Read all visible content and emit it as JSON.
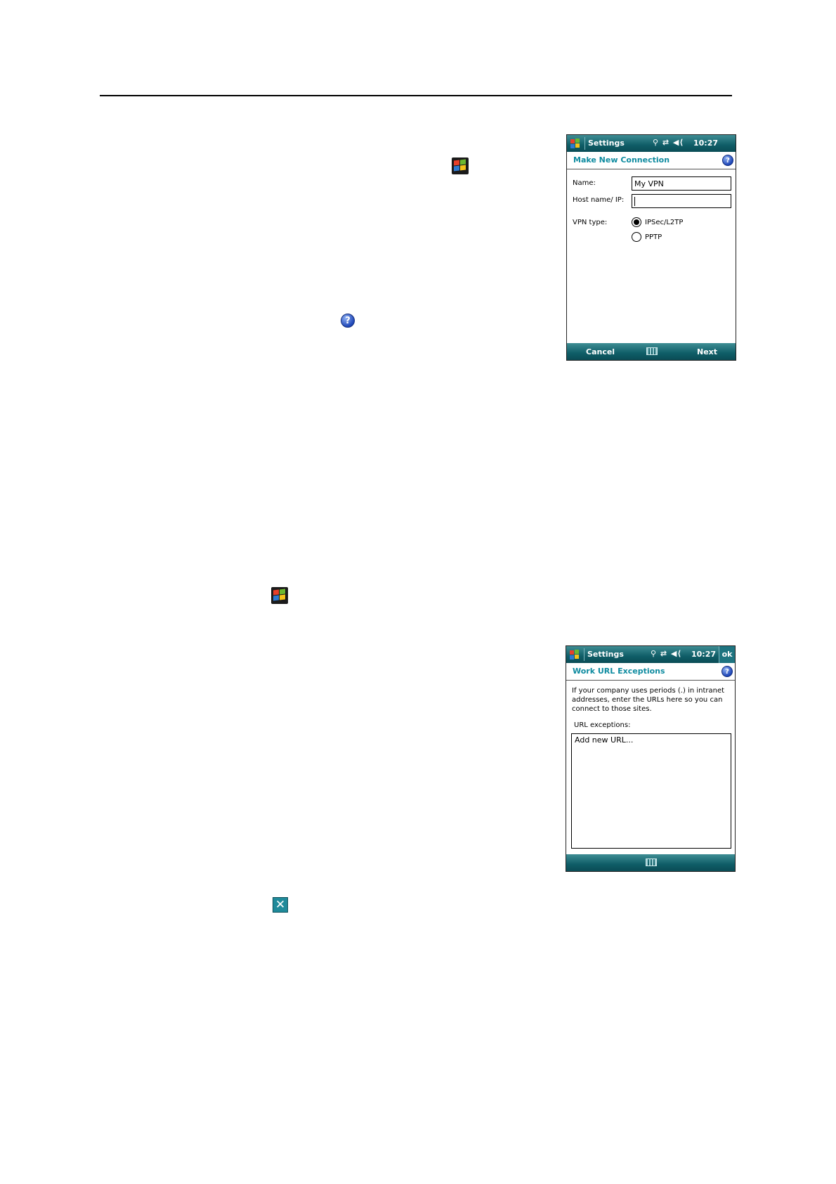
{
  "screen1": {
    "title": "Settings",
    "status_icons": "⚲ ⇄ ◀⟨",
    "time": "10:27",
    "header": "Make New Connection",
    "help_glyph": "?",
    "name_label": "Name:",
    "name_value": "My VPN",
    "host_label": "Host name/ IP:",
    "host_value": "",
    "vpn_type_label": "VPN type:",
    "options": [
      {
        "label": "IPSec/L2TP",
        "selected": true
      },
      {
        "label": "PPTP",
        "selected": false
      }
    ],
    "softkey_left": "Cancel",
    "softkey_right": "Next"
  },
  "screen2": {
    "title": "Settings",
    "status_icons": "⚲ ⇄ ◀⟨",
    "time": "10:27",
    "ok_label": "ok",
    "header": "Work URL Exceptions",
    "help_glyph": "?",
    "description": "If your company uses periods (.) in intranet addresses, enter the URLs here so you can connect to those sites.",
    "list_label": "URL exceptions:",
    "list_item": "Add new URL..."
  },
  "icons": {
    "help_glyph": "?",
    "close_glyph": "✕"
  }
}
